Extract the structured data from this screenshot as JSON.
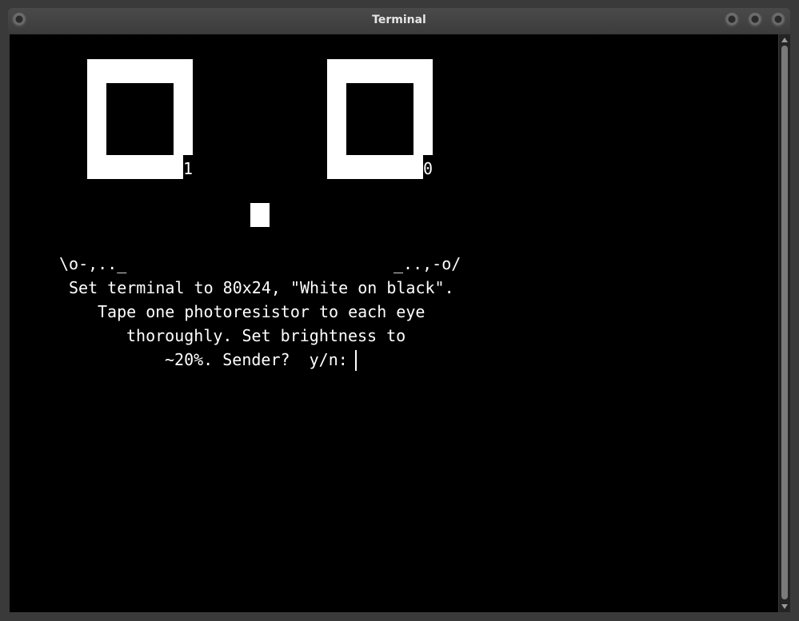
{
  "window": {
    "title": "Terminal"
  },
  "terminal": {
    "eyes": [
      {
        "label": "1"
      },
      {
        "label": "0"
      }
    ],
    "whisker_left": "\\o-,.._",
    "whisker_right": "_..,-o/",
    "lines": [
      "Set terminal to 80x24, \"White on black\".",
      "Tape one photoresistor to each eye",
      "thoroughly. Set brightness to",
      "~20%. Sender?  y/n:"
    ]
  },
  "colors": {
    "background": "#000000",
    "foreground": "#ffffff"
  }
}
